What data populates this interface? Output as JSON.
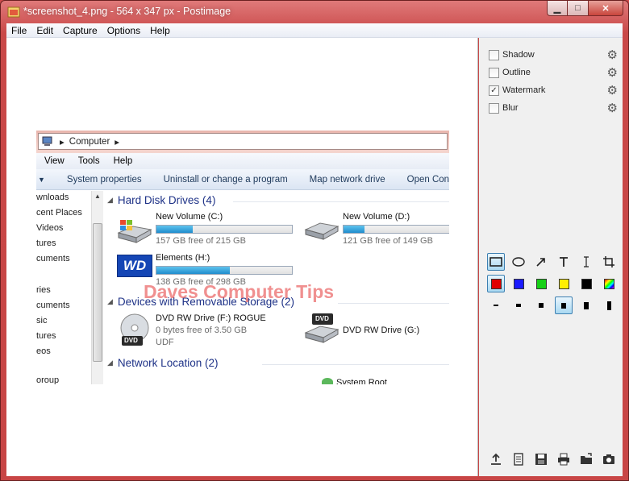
{
  "window": {
    "title": "*screenshot_4.png - 564 x 347 px - Postimage"
  },
  "window_controls": {
    "minimize": "▁",
    "maximize": "□",
    "close": "✕"
  },
  "menu": [
    "File",
    "Edit",
    "Capture",
    "Options",
    "Help"
  ],
  "shot": {
    "address": "Computer",
    "menu": [
      "View",
      "Tools",
      "Help"
    ],
    "commands": [
      "System properties",
      "Uninstall or change a program",
      "Map network drive",
      "Open Control P"
    ],
    "nav_items": [
      "wnloads",
      "cent Places",
      "Videos",
      "tures",
      "cuments",
      "ries",
      "cuments",
      "sic",
      "tures",
      "eos",
      "oroup"
    ],
    "groups": {
      "hdd": "Hard Disk Drives (4)",
      "removable": "Devices with Removable Storage (2)",
      "network": "Network Location (2)"
    },
    "drives": [
      {
        "name": "New Volume (C:)",
        "free": "157 GB free of 215 GB",
        "used_fraction": 0.27
      },
      {
        "name": "New Volume (D:)",
        "free": "121 GB free of 149 GB",
        "used_fraction": 0.19
      },
      {
        "name": "Elements (H:)",
        "free": "138 GB free of 298 GB",
        "used_fraction": 0.54
      }
    ],
    "dvd": [
      {
        "name": "DVD RW Drive (F:) ROGUE",
        "line2": "0 bytes free of 3.50 GB",
        "line3": "UDF"
      },
      {
        "name": "DVD RW Drive (G:)"
      }
    ],
    "wd_logo": "WD",
    "dvd_badge": "DVD",
    "network_item": "System Root"
  },
  "watermark": "Daves Computer Tips",
  "effects": [
    {
      "label": "Shadow",
      "checked": false
    },
    {
      "label": "Outline",
      "checked": false
    },
    {
      "label": "Watermark",
      "checked": true
    },
    {
      "label": "Blur",
      "checked": false
    }
  ],
  "colors": {
    "red": "#e00000",
    "blue": "#1a1aff",
    "green": "#16d016",
    "yellow": "#ffee00",
    "black": "#000000"
  },
  "icons": {
    "rectangle": "rectangle-tool-icon",
    "ellipse": "ellipse-tool-icon",
    "arrow": "arrow-tool-icon",
    "text": "text-tool-icon",
    "cursor": "text-cursor-icon",
    "crop": "crop-tool-icon"
  }
}
